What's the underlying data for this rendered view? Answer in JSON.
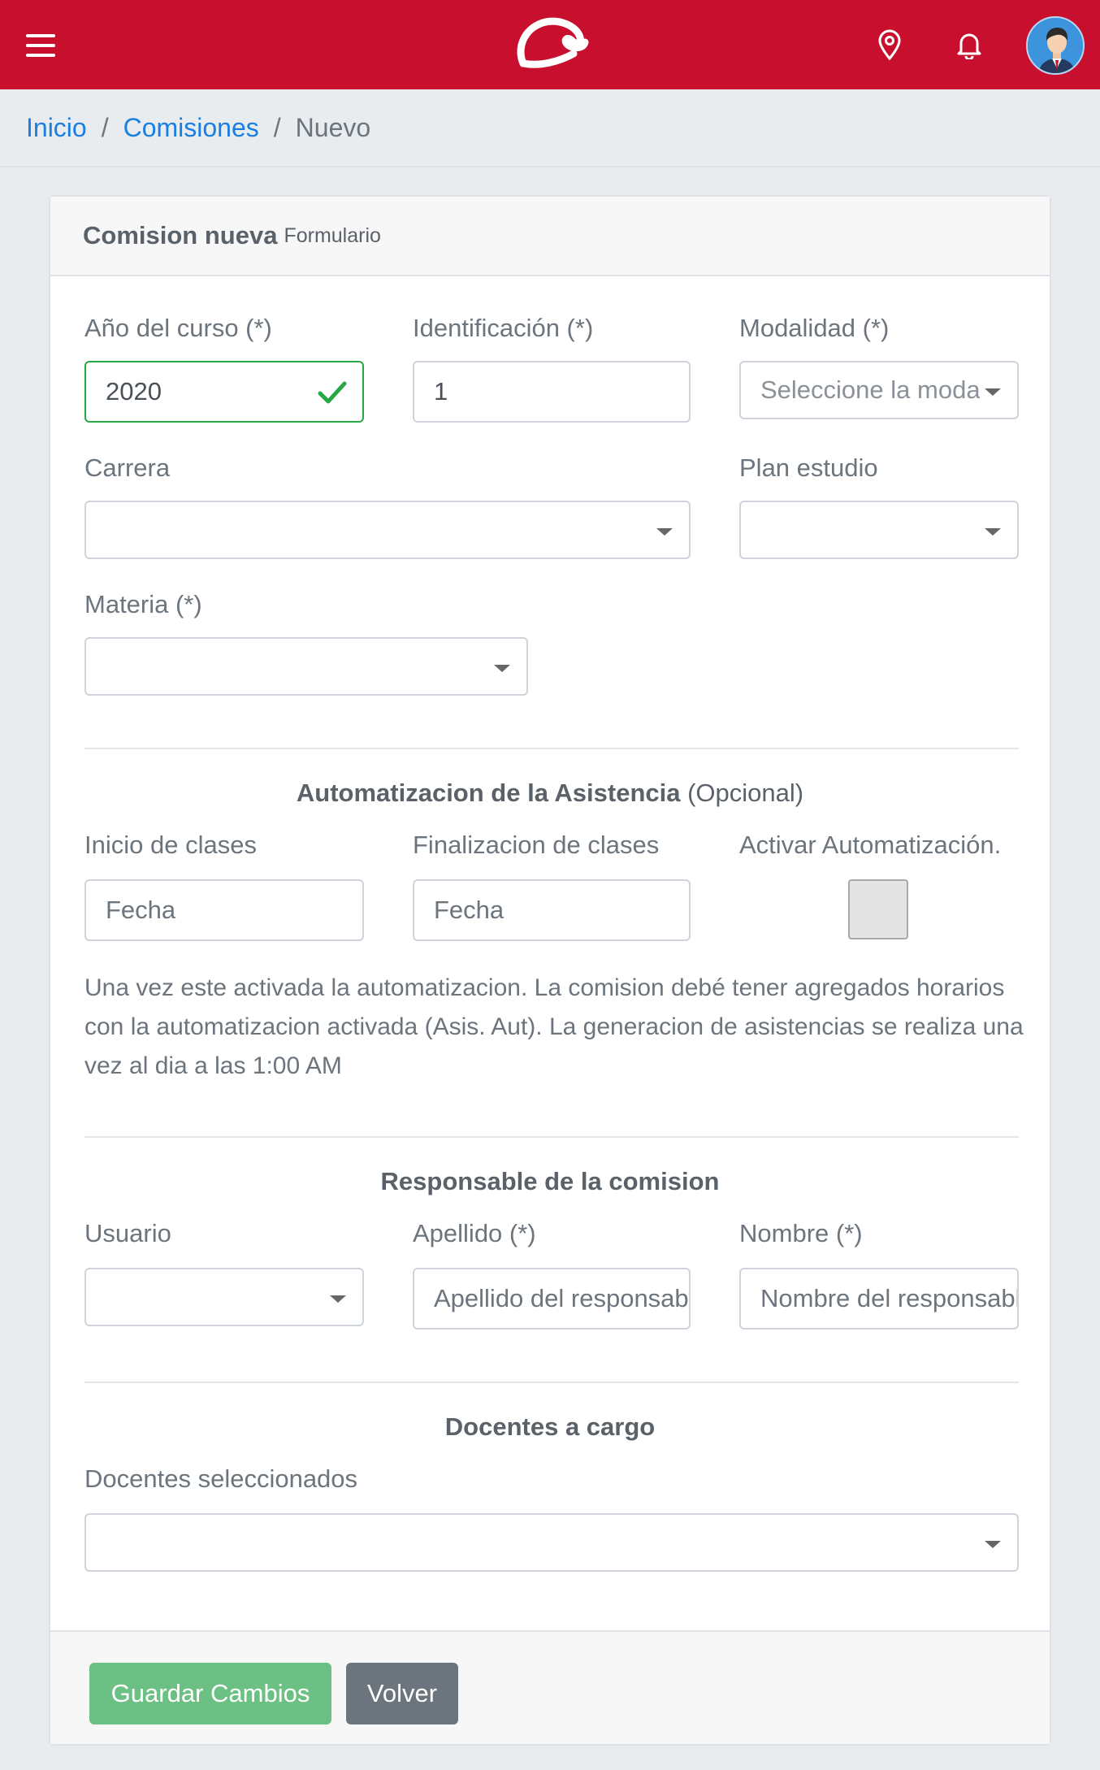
{
  "navbar": {
    "menu_icon": "hamburger-menu-icon",
    "logo_icon": "app-logo",
    "location_icon": "location-pin-icon",
    "notification_icon": "bell-icon",
    "avatar_icon": "user-avatar",
    "background_color": "#c8102e"
  },
  "breadcrumb": {
    "items": [
      "Inicio",
      "Comisiones"
    ],
    "separator": "/",
    "current": "Nuevo"
  },
  "card": {
    "title": "Comision nueva",
    "subtitle": "Formulario"
  },
  "form": {
    "anio": {
      "label": "Año del curso (*)",
      "value": "2020",
      "state": "valid"
    },
    "identificacion": {
      "label": "Identificación (*)",
      "value": "1"
    },
    "modalidad": {
      "label": "Modalidad (*)",
      "placeholder": "Seleccione la modalidad"
    },
    "carrera": {
      "label": "Carrera",
      "value": ""
    },
    "plan": {
      "label": "Plan estudio",
      "value": ""
    },
    "materia": {
      "label": "Materia (*)",
      "value": ""
    }
  },
  "asistencia": {
    "title": "Automatizacion de la Asistencia",
    "title_suffix": "(Opcional)",
    "inicio": {
      "label": "Inicio de clases",
      "placeholder": "Fecha"
    },
    "fin": {
      "label": "Finalizacion de clases",
      "placeholder": "Fecha"
    },
    "activar": {
      "label": "Activar Automatización.",
      "checked": false
    },
    "help_text": "Una vez este activada la automatizacion. La comision debé tener agregados horarios con la automatizacion activada (Asis. Aut). La generacion de asistencias se realiza una vez al dia a las 1:00 AM"
  },
  "responsable": {
    "title": "Responsable de la comision",
    "usuario": {
      "label": "Usuario",
      "value": ""
    },
    "apellido": {
      "label": "Apellido (*)",
      "placeholder": "Apellido del responsable"
    },
    "nombre": {
      "label": "Nombre (*)",
      "placeholder": "Nombre del responsable"
    }
  },
  "docentes": {
    "title": "Docentes a cargo",
    "label": "Docentes seleccionados",
    "value": ""
  },
  "footer": {
    "save_label": "Guardar Cambios",
    "back_label": "Volver",
    "save_color": "#6cc083",
    "back_color": "#6c757d"
  }
}
